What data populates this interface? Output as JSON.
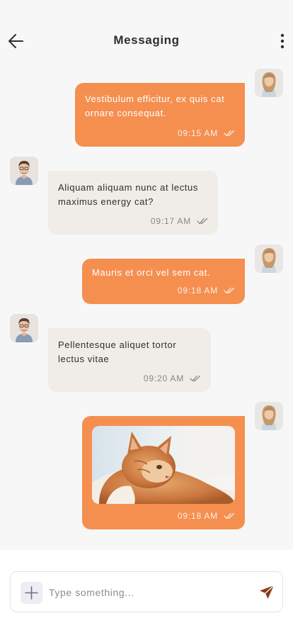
{
  "header": {
    "title": "Messaging",
    "back_icon": "arrow-left-icon",
    "menu_icon": "more-vertical-icon"
  },
  "messages": [
    {
      "sender": "me",
      "text": "Vestibulum efficitur, ex quis cat ornare consequat.",
      "time": "09:15 AM",
      "status": "read"
    },
    {
      "sender": "them",
      "text": "Aliquam aliquam nunc at lectus maximus energy cat?",
      "time": "09:17 AM",
      "status": "read"
    },
    {
      "sender": "me",
      "text": "Mauris et orci vel sem cat.",
      "time": "09:18 AM",
      "status": "read"
    },
    {
      "sender": "them",
      "text": "Pellentesque aliquet tortor lectus vitae",
      "time": "09:20 AM",
      "status": "read"
    },
    {
      "sender": "me",
      "type": "image",
      "image": "orange-cat-photo",
      "time": "09:18 AM",
      "status": "read"
    }
  ],
  "composer": {
    "placeholder": "Type something...",
    "value": "",
    "attach_icon": "plus-icon",
    "send_icon": "send-icon"
  },
  "colors": {
    "outgoing_bubble": "#f58f50",
    "incoming_bubble": "#f0ece8",
    "background": "#f7f7f7"
  }
}
